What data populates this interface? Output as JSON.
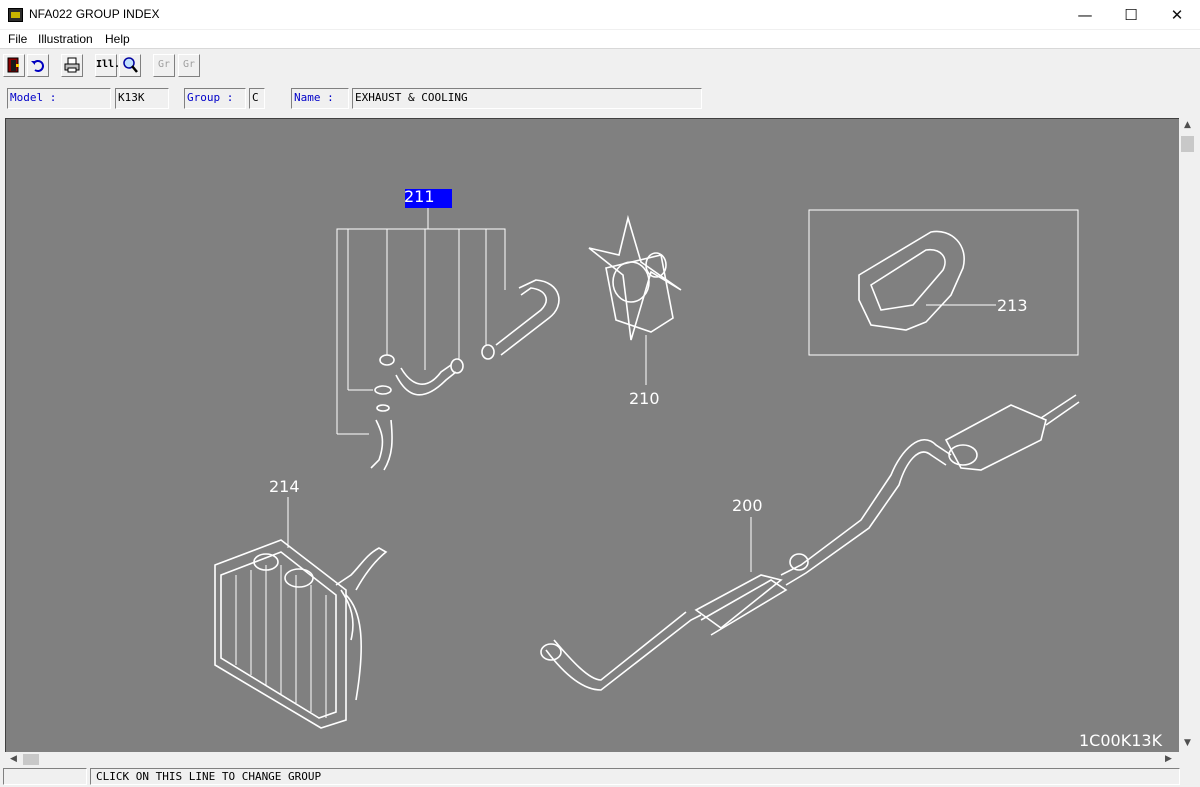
{
  "window": {
    "title": "NFA022 GROUP INDEX",
    "minimize_glyph": "—",
    "maximize_glyph": "☐",
    "close_glyph": "✕"
  },
  "menu": {
    "items": [
      "File",
      "Illustration",
      "Help"
    ]
  },
  "toolbar": {
    "buttons": [
      {
        "icon": "exit-icon",
        "label": ""
      },
      {
        "icon": "undo-icon",
        "label": "↶"
      },
      {
        "icon": "print-icon",
        "label": "🖶"
      },
      {
        "icon": "parts-list-icon",
        "label": "Ill."
      },
      {
        "icon": "zoom-icon",
        "label": "🔍"
      },
      {
        "icon": "prev-group-icon",
        "label": "Gr"
      },
      {
        "icon": "next-group-icon",
        "label": "Gr"
      }
    ]
  },
  "info": {
    "model_label": "Model :",
    "model_value": "K13K",
    "group_label": "Group :",
    "group_value": "C",
    "name_label": "Name :",
    "name_value": "EXHAUST & COOLING"
  },
  "illustration": {
    "callouts": {
      "c211": "211",
      "c210": "210",
      "c213": "213",
      "c214": "214",
      "c200": "200"
    },
    "drawing_code": "1C00K13K",
    "selected_callout": "211",
    "colors": {
      "background": "#808080",
      "linework": "#ffffff",
      "highlight": "#0000ff"
    }
  },
  "status": {
    "text": "CLICK ON THIS LINE TO CHANGE GROUP"
  }
}
